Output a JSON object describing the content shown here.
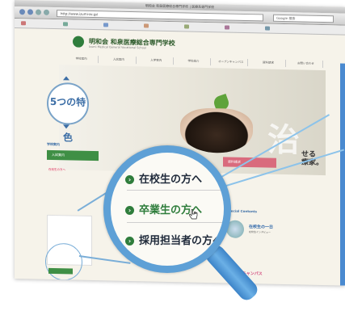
{
  "browser": {
    "title_text": "明和会 和泉医療総合専門学校 | 医療系専門学校",
    "url_text": "http://www.izumi-ac.jp/",
    "search_text": "Google 検索"
  },
  "site": {
    "logo_title": "明和会 和泉医療総合専門学校",
    "logo_subtitle": "Izumi Medical General Vocational School",
    "nav_items": [
      "学校案内",
      "入試案内",
      "入学案内",
      "学科紹介",
      "オープンキャンパス",
      "資料請求",
      "お問い合わせ"
    ],
    "hero_kanji": "治",
    "hero_tagline_line1": "せる",
    "hero_tagline_line2": "療家。",
    "feature_label": "5つの特色",
    "guide_label": "学校案内",
    "card_left": "入試案内",
    "card_right": "資料請求",
    "mini_left": "在校生の方へ",
    "right_title": "Special Contents",
    "right_link": "在校生の一日",
    "right_sub": "在校生インタビュー",
    "open_campus": "オープンキャンパス"
  },
  "magnifier": {
    "items": [
      {
        "label": "在校生の方へ",
        "highlight": false
      },
      {
        "label": "卒業生の方へ",
        "highlight": true
      },
      {
        "label": "採用担当者の方へ",
        "highlight": false
      }
    ]
  },
  "colors": {
    "accent_blue": "#5ea0d6",
    "brand_green": "#2f7d3c"
  }
}
